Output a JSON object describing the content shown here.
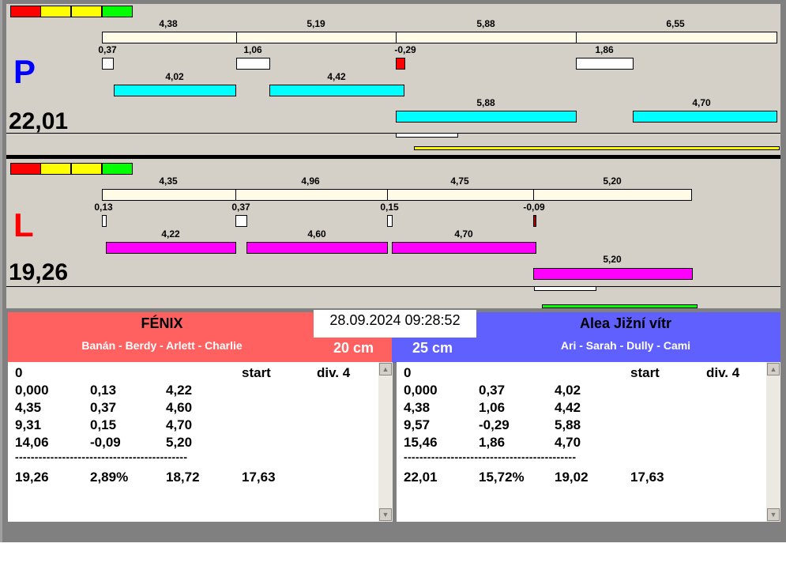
{
  "legend_colors": [
    "#ff0000",
    "#ffff00",
    "#ffff00",
    "#00ff00"
  ],
  "P": {
    "letter": "P",
    "total": "22,01",
    "top": [
      "4,38",
      "5,19",
      "5,88",
      "6,55"
    ],
    "small": [
      "0,37",
      "1,06",
      "-0,29",
      "1,86"
    ],
    "row1": [
      "4,02",
      "4,42"
    ],
    "row2": [
      "5,88",
      "4,70"
    ]
  },
  "L": {
    "letter": "L",
    "total": "19,26",
    "top": [
      "4,35",
      "4,96",
      "4,75",
      "5,20"
    ],
    "small": [
      "0,13",
      "0,37",
      "0,15",
      "-0,09"
    ],
    "row1": [
      "4,22",
      "4,60",
      "4,70"
    ],
    "row2": [
      "5,20"
    ]
  },
  "datetime": "28.09.2024 09:28:52",
  "left": {
    "team": "FÉNIX",
    "members": "Banán - Berdy - Arlett - Charlie",
    "distance": "20 cm",
    "color": "#ff6060",
    "header": [
      "0",
      "start",
      "div. 4"
    ],
    "rows": [
      [
        "0,000",
        "0,13",
        "4,22"
      ],
      [
        "4,35",
        "0,37",
        "4,60"
      ],
      [
        "9,31",
        "0,15",
        "4,70"
      ],
      [
        "14,06",
        "-0,09",
        "5,20"
      ]
    ],
    "divider": "--------------------------------------------",
    "summary": [
      "19,26",
      "2,89%",
      "18,72",
      "17,63"
    ]
  },
  "right": {
    "team": "Alea Jižní vítr",
    "members": "Ari - Sarah - Dully - Cami",
    "distance": "25 cm",
    "color": "#6060ff",
    "header": [
      "0",
      "start",
      "div. 4"
    ],
    "rows": [
      [
        "0,000",
        "0,37",
        "4,02"
      ],
      [
        "4,38",
        "1,06",
        "4,42"
      ],
      [
        "9,57",
        "-0,29",
        "5,88"
      ],
      [
        "15,46",
        "1,86",
        "4,70"
      ]
    ],
    "divider": "--------------------------------------------",
    "summary": [
      "22,01",
      "15,72%",
      "19,02",
      "17,63"
    ]
  }
}
